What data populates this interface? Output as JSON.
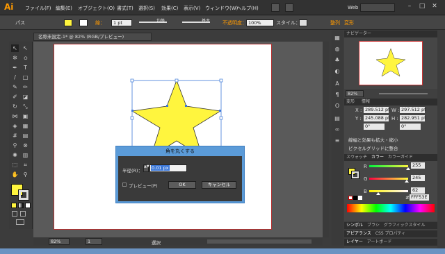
{
  "app": {
    "logo": "Ai"
  },
  "menu": [
    "ファイル(F)",
    "編集(E)",
    "オブジェクト(O)",
    "書式(T)",
    "選択(S)",
    "効果(C)",
    "表示(V)",
    "ウィンドウ(W)",
    "ヘルプ(H)"
  ],
  "workspace": "Web",
  "control": {
    "selection": "パス",
    "stroke_label": "線：",
    "stroke_weight": "1 pt",
    "uniform": "均等",
    "basic": "基本",
    "opacity_label": "不透明度：",
    "opacity": "100%",
    "style_label": "スタイル：",
    "transform": "整列",
    "transform2": "変形"
  },
  "document": {
    "tab": "名称未設定-1* @ 82% (RGB/プレビュー)",
    "zoom": "82%",
    "page": "1",
    "tool": "選択"
  },
  "star": {
    "fill": "#fff53e",
    "stroke": "#333333"
  },
  "dialog": {
    "title": "角を丸くする",
    "radius_label": "半径(R)：",
    "radius_value": "0.01 px",
    "preview": "プレビュー(P)",
    "ok": "OK",
    "cancel": "キャンセル"
  },
  "navigator": {
    "tabs": [
      "ナビゲーター"
    ],
    "zoom": "82%"
  },
  "transform": {
    "tabs": [
      "変形",
      "情報"
    ],
    "x": "289.512 pt",
    "y": "245.088 pt",
    "w": "297.512 pt",
    "h": "282.951 pt",
    "angle": "0°",
    "shear": "0°",
    "opt1": "線幅と効果も拡大・縮小",
    "opt2": "ピクセルグリッドに整合"
  },
  "color": {
    "tabs": [
      "スウォッチ",
      "カラー",
      "カラーガイド"
    ],
    "r_label": "R",
    "r": "255",
    "g_label": "G",
    "g": "245",
    "b_label": "B",
    "b": "62",
    "hex_prefix": "#",
    "hex": "FFF53E",
    "r_frac": 1.0,
    "g_frac": 0.96,
    "b_frac": 0.24
  },
  "bottom_tabs1": [
    "シンボル",
    "ブラシ",
    "グラフィックスタイル"
  ],
  "bottom_tabs2": [
    "アピアランス",
    "CSS プロパティ"
  ],
  "bottom_tabs3": [
    "レイヤー",
    "アートボード"
  ],
  "colors": {
    "accent": "#ff9a00",
    "fill": "#fff53e",
    "selection": "#3c78d8",
    "dialog_border": "#5b9bd8"
  }
}
